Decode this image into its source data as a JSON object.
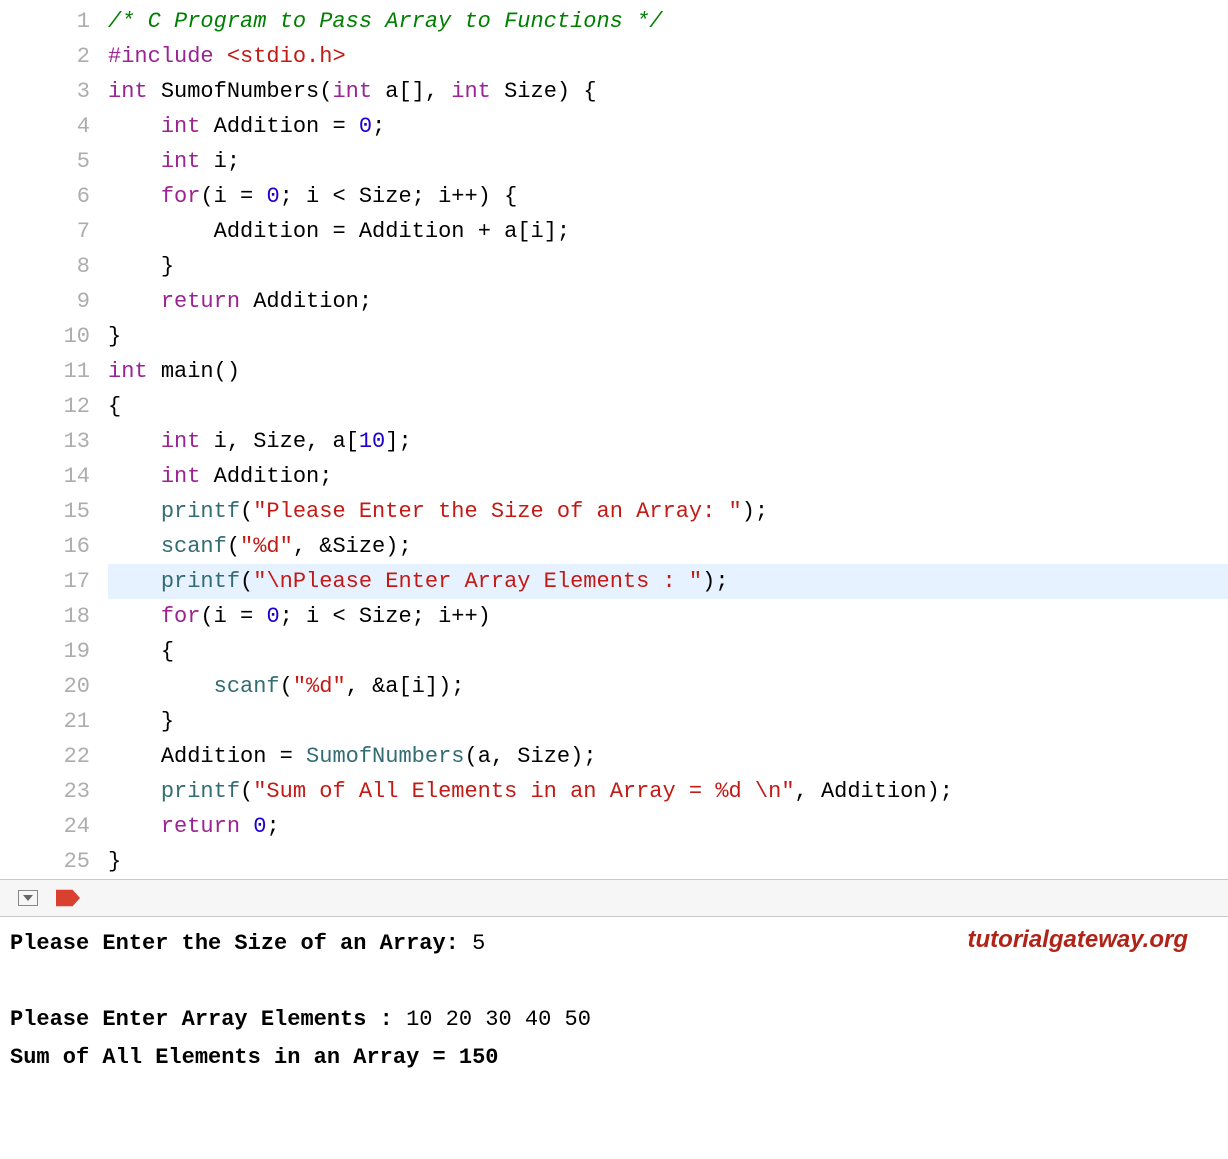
{
  "code": {
    "highlighted_line": 17,
    "lines": [
      {
        "n": 1,
        "html": "<span class='comment'>/* C Program to Pass Array to Functions */</span>"
      },
      {
        "n": 2,
        "html": "<span class='preproc'>#include</span> <span class='angle-include'>&lt;stdio.h&gt;</span>"
      },
      {
        "n": 3,
        "html": "<span class='type'>int</span> <span class='ident'>SumofNumbers</span><span class='paren'>(</span><span class='type'>int</span> <span class='ident'>a</span><span class='punct'>[]</span><span class='punct'>,</span> <span class='type'>int</span> <span class='ident'>Size</span><span class='paren'>)</span> <span class='punct'>{</span>"
      },
      {
        "n": 4,
        "html": "    <span class='type'>int</span> <span class='ident'>Addition</span> <span class='punct'>=</span> <span class='number'>0</span><span class='punct'>;</span>"
      },
      {
        "n": 5,
        "html": "    <span class='type'>int</span> <span class='ident'>i</span><span class='punct'>;</span>"
      },
      {
        "n": 6,
        "html": "    <span class='keyword'>for</span><span class='paren'>(</span><span class='ident'>i</span> <span class='punct'>=</span> <span class='number'>0</span><span class='punct'>;</span> <span class='ident'>i</span> <span class='punct'>&lt;</span> <span class='ident'>Size</span><span class='punct'>;</span> <span class='ident'>i</span><span class='punct'>++)</span> <span class='punct'>{</span>"
      },
      {
        "n": 7,
        "html": "        <span class='ident'>Addition</span> <span class='punct'>=</span> <span class='ident'>Addition</span> <span class='punct'>+</span> <span class='ident'>a</span><span class='punct'>[</span><span class='ident'>i</span><span class='punct'>];</span>"
      },
      {
        "n": 8,
        "html": "    <span class='punct'>}</span>"
      },
      {
        "n": 9,
        "html": "    <span class='keyword'>return</span> <span class='ident'>Addition</span><span class='punct'>;</span>"
      },
      {
        "n": 10,
        "html": "<span class='punct'>}</span>"
      },
      {
        "n": 11,
        "html": "<span class='type'>int</span> <span class='ident'>main</span><span class='paren'>()</span>"
      },
      {
        "n": 12,
        "html": "<span class='punct'>{</span>"
      },
      {
        "n": 13,
        "html": "    <span class='type'>int</span> <span class='ident'>i</span><span class='punct'>,</span> <span class='ident'>Size</span><span class='punct'>,</span> <span class='ident'>a</span><span class='punct'>[</span><span class='number'>10</span><span class='punct'>];</span>"
      },
      {
        "n": 14,
        "html": "    <span class='type'>int</span> <span class='ident'>Addition</span><span class='punct'>;</span>"
      },
      {
        "n": 15,
        "html": "    <span class='funccall'>printf</span><span class='paren'>(</span><span class='string'>\"Please Enter the Size of an Array: \"</span><span class='paren'>)</span><span class='punct'>;</span>"
      },
      {
        "n": 16,
        "html": "    <span class='funccall'>scanf</span><span class='paren'>(</span><span class='string'>\"</span><span class='fmt'>%d</span><span class='string'>\"</span><span class='punct'>,</span> <span class='punct'>&amp;</span><span class='ident'>Size</span><span class='paren'>)</span><span class='punct'>;</span>"
      },
      {
        "n": 17,
        "html": "    <span class='funccall'>printf</span><span class='paren'>(</span><span class='string'>\"</span><span class='escape'>\\n</span><span class='string'>Please Enter Array Elements : \"</span><span class='paren'>)</span><span class='punct'>;</span>"
      },
      {
        "n": 18,
        "html": "    <span class='keyword'>for</span><span class='paren'>(</span><span class='ident'>i</span> <span class='punct'>=</span> <span class='number'>0</span><span class='punct'>;</span> <span class='ident'>i</span> <span class='punct'>&lt;</span> <span class='ident'>Size</span><span class='punct'>;</span> <span class='ident'>i</span><span class='punct'>++)</span>"
      },
      {
        "n": 19,
        "html": "    <span class='punct'>{</span>"
      },
      {
        "n": 20,
        "html": "        <span class='funccall'>scanf</span><span class='paren'>(</span><span class='string'>\"</span><span class='fmt'>%d</span><span class='string'>\"</span><span class='punct'>,</span> <span class='punct'>&amp;</span><span class='ident'>a</span><span class='punct'>[</span><span class='ident'>i</span><span class='punct'>]);</span>"
      },
      {
        "n": 21,
        "html": "    <span class='punct'>}</span>"
      },
      {
        "n": 22,
        "html": "    <span class='ident'>Addition</span> <span class='punct'>=</span> <span class='funccall'>SumofNumbers</span><span class='paren'>(</span><span class='ident'>a</span><span class='punct'>,</span> <span class='ident'>Size</span><span class='paren'>)</span><span class='punct'>;</span>"
      },
      {
        "n": 23,
        "html": "    <span class='funccall'>printf</span><span class='paren'>(</span><span class='string'>\"Sum of All Elements in an Array = </span><span class='fmt'>%d</span><span class='string'> </span><span class='escape'>\\n</span><span class='string'>\"</span><span class='punct'>,</span> <span class='ident'>Addition</span><span class='paren'>)</span><span class='punct'>;</span>"
      },
      {
        "n": 24,
        "html": "    <span class='keyword'>return</span> <span class='number'>0</span><span class='punct'>;</span>"
      },
      {
        "n": 25,
        "html": "<span class='punct'>}</span>"
      }
    ]
  },
  "output": {
    "watermark": "tutorialgateway.org",
    "lines": [
      {
        "bold_prefix": "Please Enter the Size of an Array: ",
        "rest": "5"
      },
      {
        "bold_prefix": "",
        "rest": ""
      },
      {
        "bold_prefix": "Please Enter Array Elements : ",
        "rest": "10 20 30 40 50"
      },
      {
        "bold_prefix": "Sum of All Elements in an Array = 150",
        "rest": ""
      }
    ]
  }
}
